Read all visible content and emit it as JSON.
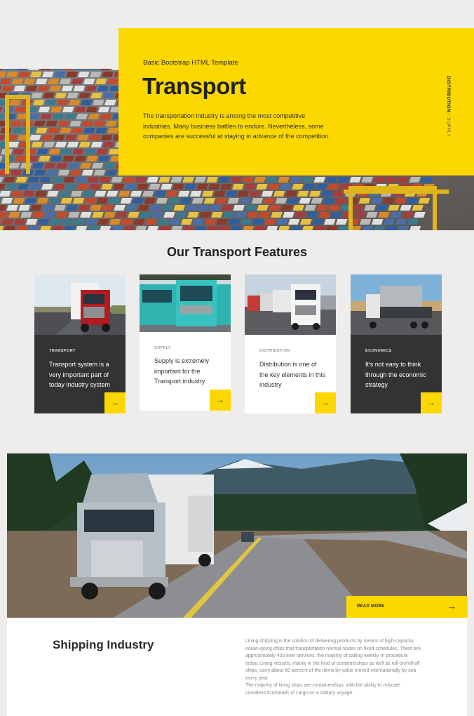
{
  "hero": {
    "subtitle": "Basic Bootstrap HTML Template",
    "title": "Transport",
    "text": "The transportation industry is among the most competitive industries. Many business battles to endure. Nevertheless, some companies are successful at staying in advance of the competition.",
    "vertical_strong": "DISTRIBUTION",
    "vertical_sep": " / ",
    "vertical_light": "SUPPLY",
    "accent": "#fcd800"
  },
  "features": {
    "title": "Our Transport Features",
    "cards": [
      {
        "category": "TRANSPORT",
        "text": "Transport system is a very important part of today industry system",
        "arrow": "→",
        "theme": "dark"
      },
      {
        "category": "SUPPLY",
        "text": "Supply is extremely important for the Transport industry",
        "arrow": "→",
        "theme": "light"
      },
      {
        "category": "DISTRIBUTION",
        "text": "Distribution is one of the key elements in this industry",
        "arrow": "→",
        "theme": "light"
      },
      {
        "category": "ECONOMICS",
        "text": "It's not easy to think through the economic strategy",
        "arrow": "→",
        "theme": "dark"
      }
    ]
  },
  "shipping": {
    "read_more": "READ MORE",
    "read_more_arrow": "→",
    "title": "Shipping Industry",
    "text": "Lining shipping is the solution of delivering products by means of high-capacity, ocean-going ships that transportation normal routes on fixed schedules. There are approximately 400 liner services, the majority of sailing weekly, in procedure today. Lining vessels, mainly in the kind of containerships as well as roll-on/roll-off ships, carry about 60 percent of the items by value moved internationally by sea every year.\nThe majority of lining ships are containerships, with the ability to relocate countless truckloads of cargo on a solitary voyage."
  },
  "icons": [
    "arrow-right-icon"
  ]
}
